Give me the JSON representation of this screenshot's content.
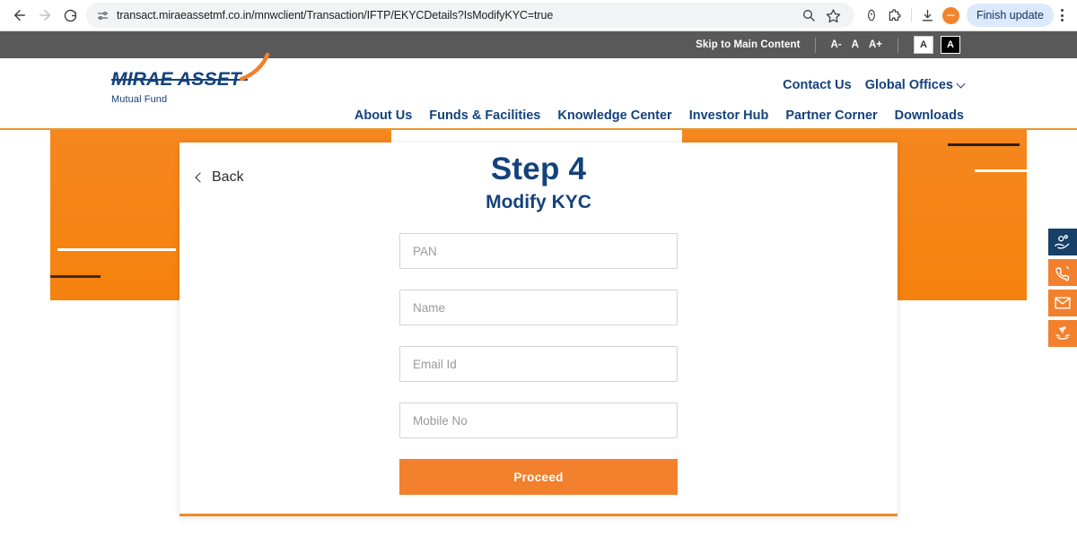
{
  "browser": {
    "url": "transact.miraeassetmf.co.in/mnwclient/Transaction/IFTP/EKYCDetails?IsModifyKYC=true",
    "finish_update_label": "Finish update",
    "icons": {
      "back": "back-arrow-icon",
      "forward": "forward-arrow-icon",
      "reload": "reload-icon",
      "site_settings": "site-settings-tune-icon",
      "search": "search-icon",
      "bookmark": "star-bookmark-icon",
      "password": "password-key-icon",
      "extensions": "extensions-puzzle-icon",
      "downloads": "downloads-icon",
      "profile": "profile-avatar-icon",
      "menu": "kebab-menu-icon"
    }
  },
  "accessibility_bar": {
    "skip_link": "Skip to Main Content",
    "font_decrease": "A-",
    "font_normal": "A",
    "font_increase": "A+",
    "contrast_light": "A",
    "contrast_dark": "A"
  },
  "header": {
    "logo_main": "MIRAE ASSET",
    "logo_sub": "Mutual Fund",
    "top_links": [
      {
        "label": "Contact Us",
        "has_chevron": false
      },
      {
        "label": "Global Offices",
        "has_chevron": true
      }
    ],
    "nav_items": [
      {
        "label": "About Us"
      },
      {
        "label": "Funds & Facilities"
      },
      {
        "label": "Knowledge Center"
      },
      {
        "label": "Investor Hub"
      },
      {
        "label": "Partner Corner"
      },
      {
        "label": "Downloads"
      }
    ]
  },
  "card": {
    "back_label": "Back",
    "title": "Step 4",
    "subtitle": "Modify KYC",
    "fields": [
      {
        "name": "pan",
        "placeholder": "PAN",
        "value": ""
      },
      {
        "name": "name",
        "placeholder": "Name",
        "value": ""
      },
      {
        "name": "email",
        "placeholder": "Email Id",
        "value": ""
      },
      {
        "name": "mobile",
        "placeholder": "Mobile No",
        "value": ""
      }
    ],
    "proceed_label": "Proceed"
  },
  "side_rail": [
    {
      "name": "invest-hand-coins-icon",
      "style": "navy"
    },
    {
      "name": "phone-call-icon",
      "style": "orange"
    },
    {
      "name": "email-envelope-icon",
      "style": "orange"
    },
    {
      "name": "hand-plant-growth-icon",
      "style": "orange"
    }
  ],
  "colors": {
    "brand_orange": "#f5820d",
    "brand_navy": "#14427b",
    "accessibility_bar": "#595959",
    "button_orange": "#f2802c"
  }
}
